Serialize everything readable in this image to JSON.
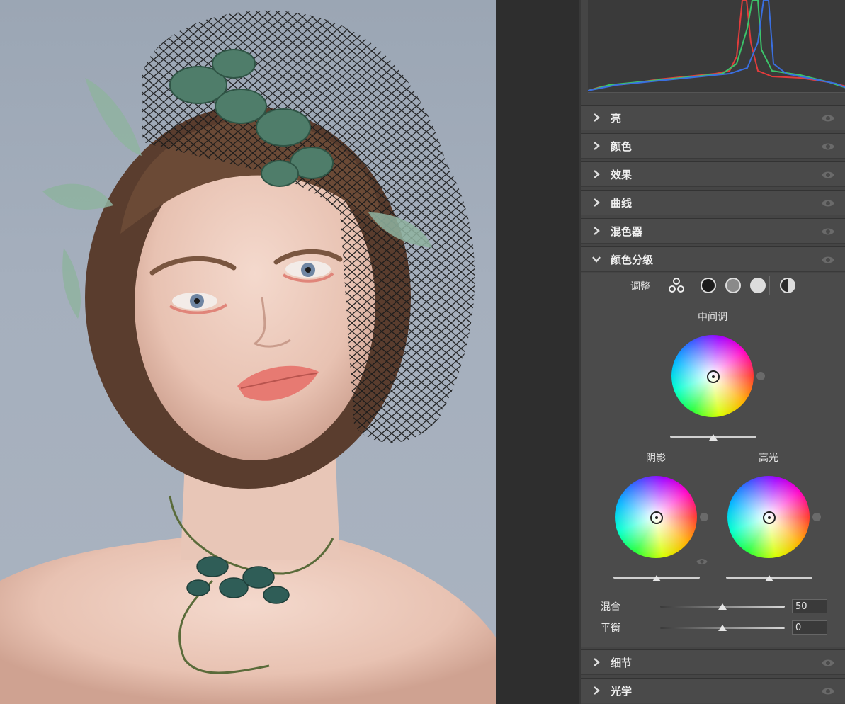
{
  "panel": {
    "sections": [
      {
        "label": "亮",
        "expanded": false
      },
      {
        "label": "颜色",
        "expanded": false
      },
      {
        "label": "效果",
        "expanded": false
      },
      {
        "label": "曲线",
        "expanded": false
      },
      {
        "label": "混色器",
        "expanded": false
      },
      {
        "label": "颜色分级",
        "expanded": true
      },
      {
        "label": "细节",
        "expanded": false
      },
      {
        "label": "光学",
        "expanded": false
      }
    ]
  },
  "grading": {
    "adjust_label": "调整",
    "midtones_label": "中间调",
    "shadows_label": "阴影",
    "highlights_label": "高光",
    "blend_label": "混合",
    "blend_value": "50",
    "blend_level": 0.5,
    "balance_label": "平衡",
    "balance_value": "0",
    "balance_level": 0.5,
    "midtones_luminance": 0.5,
    "shadows_luminance": 0.5,
    "highlights_luminance": 0.5
  },
  "colors": {
    "hist_red": "#e23c3c",
    "hist_green": "#3cc46a",
    "hist_blue": "#3a6fe0"
  },
  "icons": {
    "chevron_collapsed": "chevron-right-icon",
    "chevron_expanded": "chevron-down-icon",
    "visibility": "eye-icon"
  }
}
